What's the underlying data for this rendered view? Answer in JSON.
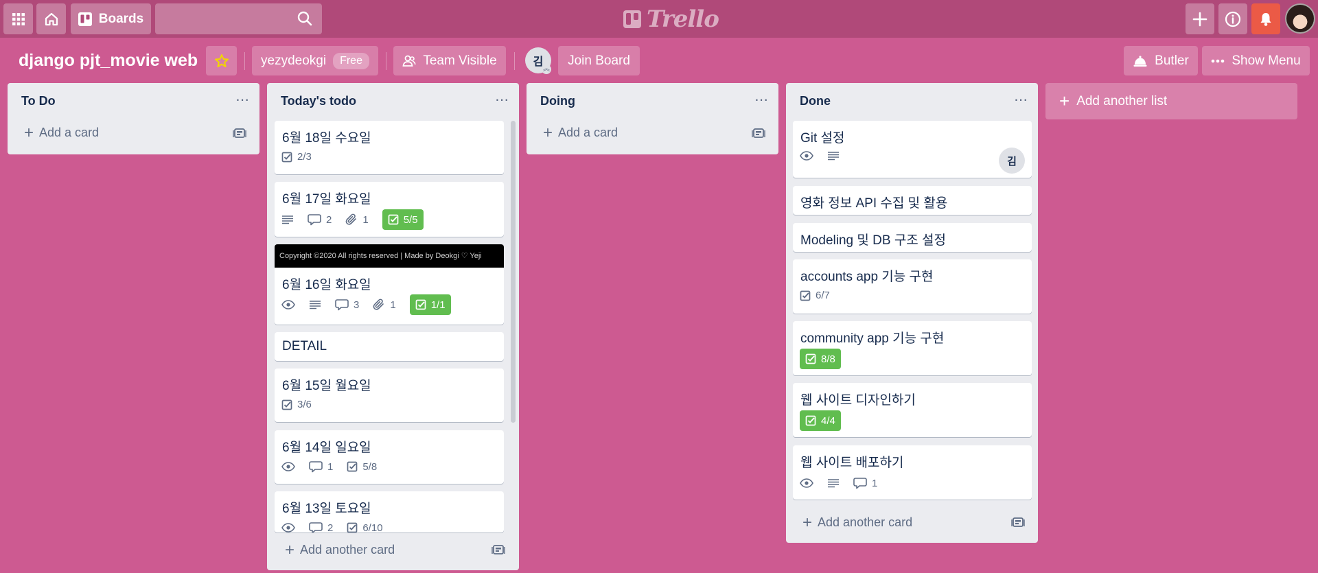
{
  "header": {
    "boards_label": "Boards",
    "search_placeholder": "",
    "logo_text": "Trello",
    "colors": {
      "header_bg": "#b04979",
      "board_bg": "#cd5a91",
      "notification": "#eb5a46"
    }
  },
  "board": {
    "title": "django pjt_movie web",
    "workspace": "yezydeokgi",
    "plan_badge": "Free",
    "visibility": "Team Visible",
    "member_initial": "김",
    "join_label": "Join Board",
    "butler_label": "Butler",
    "show_menu_label": "Show Menu"
  },
  "lists": [
    {
      "title": "To Do",
      "add_label": "Add a card",
      "cards": []
    },
    {
      "title": "Today's todo",
      "add_label": "Add another card",
      "cards": [
        {
          "title": "6월 18일 수요일",
          "checklist": "2/3"
        },
        {
          "title": "6월 17일 화요일",
          "comments": "2",
          "attachments": "1",
          "checklist_done": "5/5"
        },
        {
          "title": "6월 16일 화요일",
          "cover_text": "Copyright ©2020 All rights reserved | Made by Deokgi ♡ Yeji",
          "comments": "3",
          "attachments": "1",
          "checklist_done": "1/1"
        },
        {
          "title": "DETAIL"
        },
        {
          "title": "6월 15일 월요일",
          "checklist": "3/6"
        },
        {
          "title": "6월 14일 일요일",
          "comments": "1",
          "checklist": "5/8"
        },
        {
          "title": "6월 13일 토요일",
          "comments": "2",
          "checklist": "6/10"
        }
      ]
    },
    {
      "title": "Doing",
      "add_label": "Add a card",
      "cards": []
    },
    {
      "title": "Done",
      "add_label": "Add another card",
      "cards": [
        {
          "title": "Git 설정",
          "member": "김"
        },
        {
          "title": "영화 정보 API 수집 및 활용"
        },
        {
          "title": "Modeling 및 DB 구조 설정"
        },
        {
          "title": "accounts app 기능 구현",
          "checklist": "6/7"
        },
        {
          "title": "community app 기능 구현",
          "checklist_done": "8/8"
        },
        {
          "title": "웹 사이트 디자인하기",
          "checklist_done": "4/4"
        },
        {
          "title": "웹 사이트 배포하기",
          "comments": "1"
        }
      ]
    }
  ],
  "add_list_label": "Add another list"
}
